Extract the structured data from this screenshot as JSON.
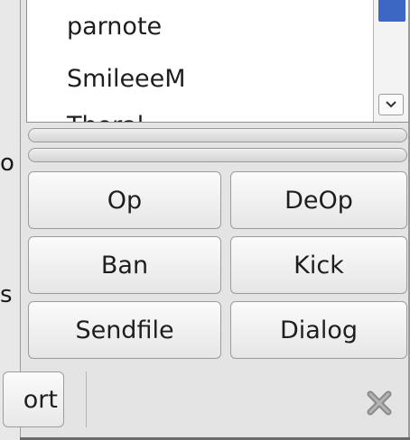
{
  "left_edge": {
    "chars": [
      "o",
      "s"
    ]
  },
  "userlist": {
    "items": [
      "parnote",
      "SmileeeM",
      "Thoral"
    ]
  },
  "progress": {
    "bar1": 0,
    "bar2": 0
  },
  "buttons": {
    "op": "Op",
    "deop": "DeOp",
    "ban": "Ban",
    "kick": "Kick",
    "sendfile": "Sendfile",
    "dialog": "Dialog"
  },
  "bottom": {
    "port_label": "ort"
  },
  "icons": {
    "close": "close-icon",
    "scroll_down": "chevron-down-icon"
  },
  "colors": {
    "scroll_thumb": "#3c67c2",
    "close_icon": "#8a8a8a"
  }
}
